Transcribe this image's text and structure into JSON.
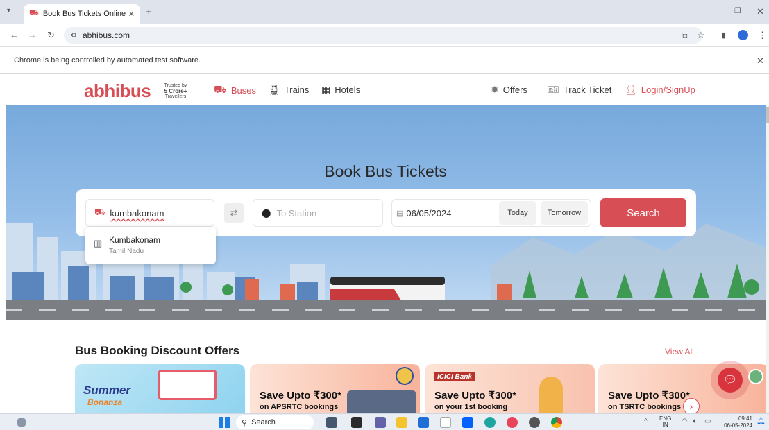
{
  "browser": {
    "tab_title": "Book Bus Tickets Online at Low",
    "url": "abhibus.com",
    "infobar_text": "Chrome is being controlled by automated test software."
  },
  "site": {
    "logo": "abhibus",
    "trusted_badge": [
      "Trusted by",
      "5 Crore+",
      "Travellers"
    ],
    "nav_left": [
      "Buses",
      "Trains",
      "Hotels"
    ],
    "nav_right": [
      "Offers",
      "Track Ticket",
      "Login/SignUp"
    ],
    "brand_color": "#d84e55"
  },
  "hero": {
    "title": "Book Bus Tickets",
    "from_value": "kumbakonam",
    "to_placeholder": "To Station",
    "date_value": "06/05/2024",
    "today_label": "Today",
    "tomorrow_label": "Tomorrow",
    "search_label": "Search",
    "suggestion": {
      "city": "Kumbakonam",
      "state": "Tamil Nadu"
    }
  },
  "offers": {
    "heading": "Bus Booking Discount Offers",
    "view_all": "View All",
    "cards": [
      {
        "line1": "Summer",
        "line2": "Bonanza"
      },
      {
        "line1": "Save Upto ₹300*",
        "line2": "on APSRTC bookings"
      },
      {
        "line1": "Save Upto ₹300*",
        "line2": "on your 1st booking",
        "badge": "ICICI Bank"
      },
      {
        "line1": "Save Upto ₹300*",
        "line2": "on TSRTC bookings"
      }
    ]
  },
  "taskbar": {
    "search_placeholder": "Search",
    "lang": "ENG",
    "region": "IN",
    "time": "09:41",
    "date": "06-05-2024"
  }
}
